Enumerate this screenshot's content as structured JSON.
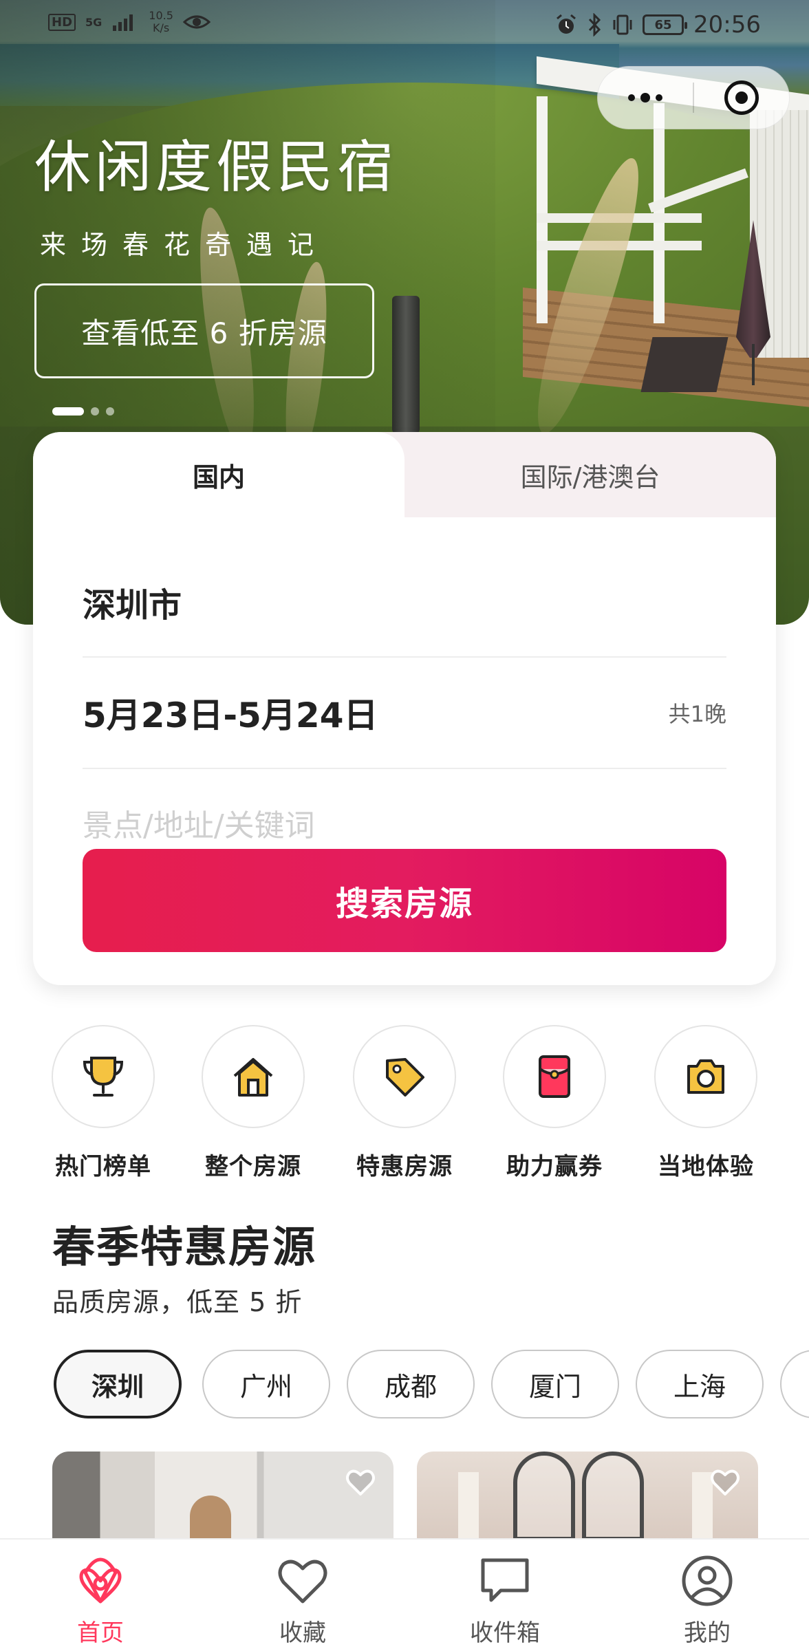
{
  "status_bar": {
    "left_indicators": [
      "HD",
      "5G"
    ],
    "net_speed_value": "10.5",
    "net_speed_unit": "K/s",
    "battery": "65",
    "time": "20:56"
  },
  "hero": {
    "title": "休闲度假民宿",
    "subtitle": "来场春花奇遇记",
    "cta_label": "查看低至 6 折房源",
    "slide_count": 3,
    "active_slide": 1
  },
  "search": {
    "tabs": [
      {
        "label": "国内",
        "active": true
      },
      {
        "label": "国际/港澳台",
        "active": false
      }
    ],
    "city": "深圳市",
    "date_range": "5月23日-5月24日",
    "nights": "共1晚",
    "keyword_placeholder": "景点/地址/关键词",
    "button_label": "搜索房源"
  },
  "categories": [
    {
      "label": "热门榜单",
      "icon": "trophy-icon"
    },
    {
      "label": "整个房源",
      "icon": "house-icon"
    },
    {
      "label": "特惠房源",
      "icon": "tag-icon"
    },
    {
      "label": "助力赢券",
      "icon": "red-envelope-icon"
    },
    {
      "label": "当地体验",
      "icon": "camera-icon"
    }
  ],
  "section": {
    "title": "春季特惠房源",
    "subtitle": "品质房源，低至 5 折",
    "cities": [
      {
        "label": "深圳",
        "active": true
      },
      {
        "label": "广州",
        "active": false
      },
      {
        "label": "成都",
        "active": false
      },
      {
        "label": "厦门",
        "active": false
      },
      {
        "label": "上海",
        "active": false
      }
    ]
  },
  "tabbar": {
    "items": [
      {
        "label": "首页",
        "icon": "airbnb-logo-icon",
        "active": true
      },
      {
        "label": "收藏",
        "icon": "heart-icon",
        "active": false
      },
      {
        "label": "收件箱",
        "icon": "chat-bubble-icon",
        "active": false
      },
      {
        "label": "我的",
        "icon": "profile-icon",
        "active": false
      }
    ]
  },
  "colors": {
    "brand": "#ff385c",
    "button_gradient_start": "#e61e4d",
    "button_gradient_end": "#d70466",
    "icon_gold": "#f5c341",
    "tab_inactive_bg": "#f6eff1"
  }
}
